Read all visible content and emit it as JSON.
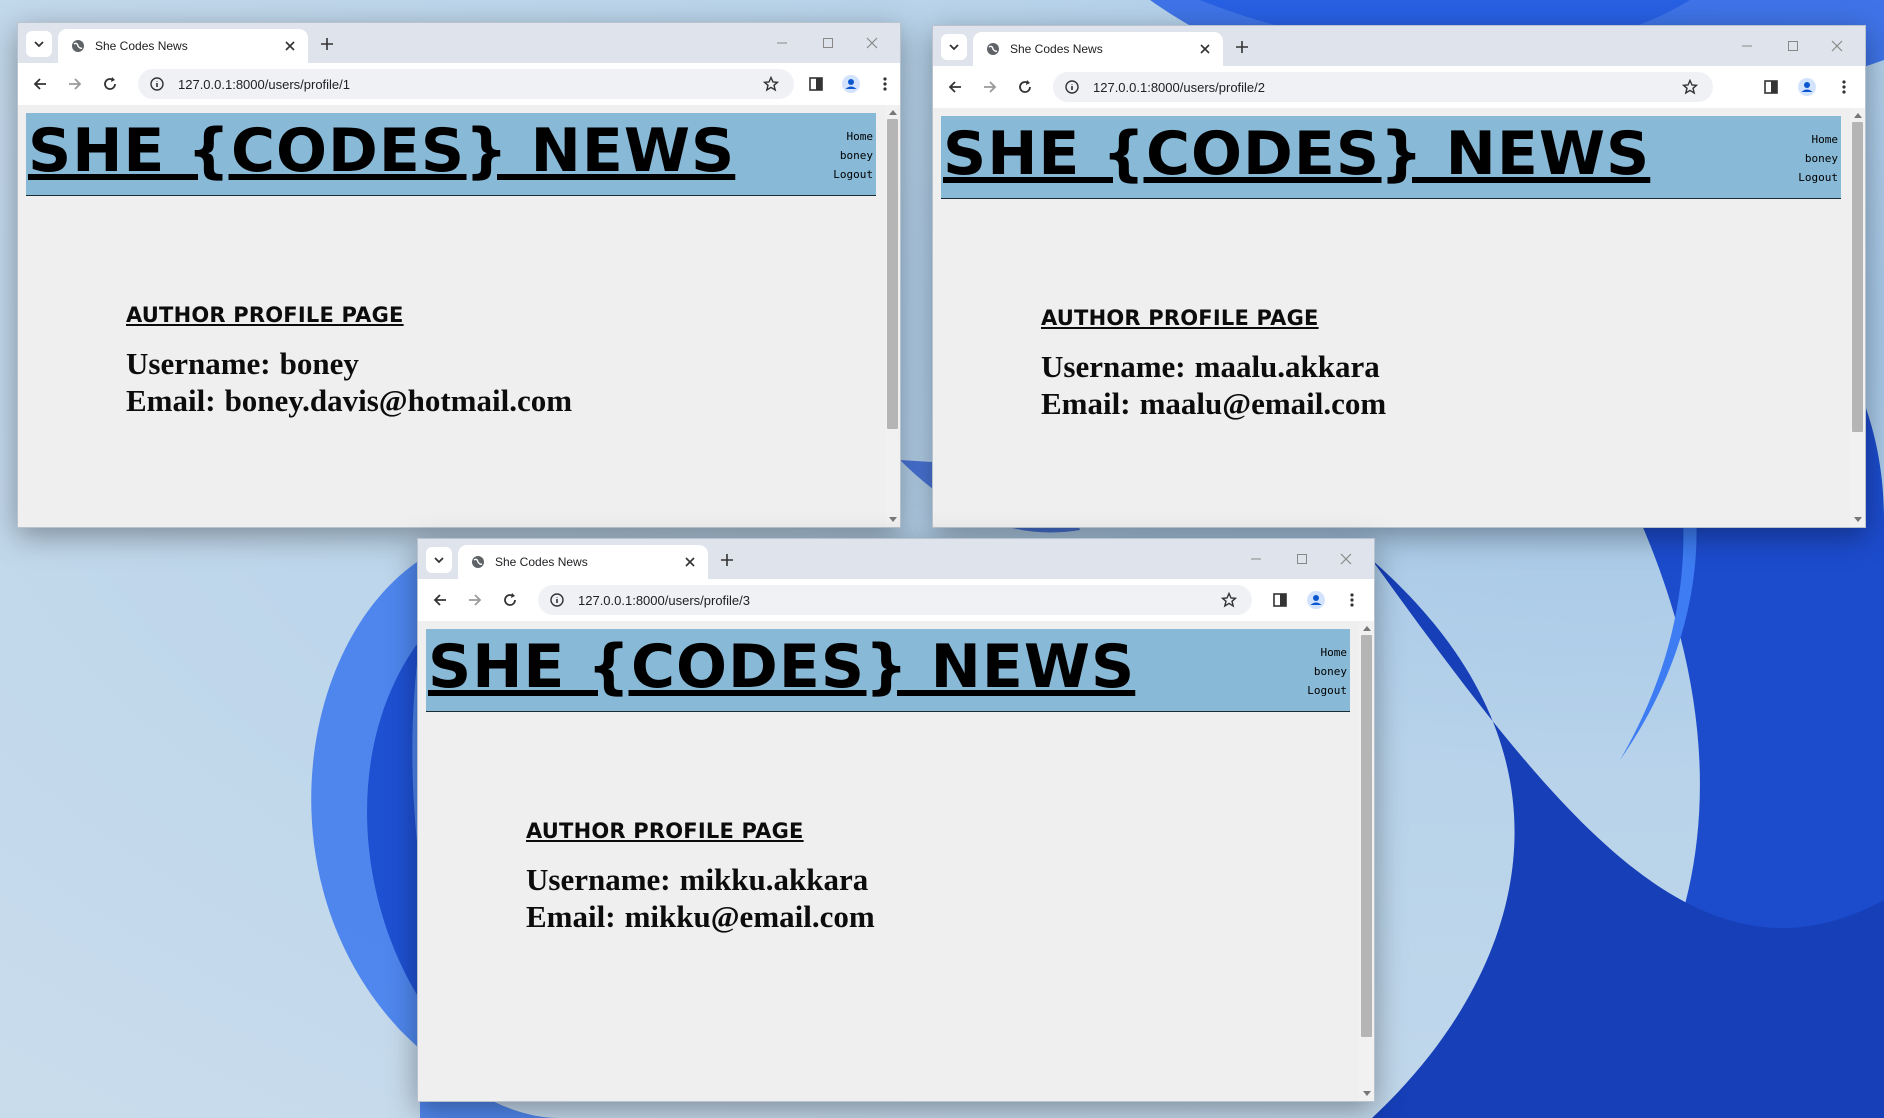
{
  "desktop": {
    "accent": "#1f56d9"
  },
  "windows": [
    {
      "tab_title": "She Codes News",
      "url": "127.0.0.1:8000/users/profile/1",
      "site_title": "SHE {CODES} NEWS",
      "nav": [
        "Home",
        "boney",
        "Logout"
      ],
      "heading": "AUTHOR PROFILE PAGE",
      "username_label": "Username:",
      "username": "boney",
      "email_label": "Email:",
      "email": "boney.davis@hotmail.com"
    },
    {
      "tab_title": "She Codes News",
      "url": "127.0.0.1:8000/users/profile/2",
      "site_title": "SHE {CODES} NEWS",
      "nav": [
        "Home",
        "boney",
        "Logout"
      ],
      "heading": "AUTHOR PROFILE PAGE",
      "username_label": "Username:",
      "username": "maalu.akkara",
      "email_label": "Email:",
      "email": "maalu@email.com"
    },
    {
      "tab_title": "She Codes News",
      "url": "127.0.0.1:8000/users/profile/3",
      "site_title": "SHE {CODES} NEWS",
      "nav": [
        "Home",
        "boney",
        "Logout"
      ],
      "heading": "AUTHOR PROFILE PAGE",
      "username_label": "Username:",
      "username": "mikku.akkara",
      "email_label": "Email:",
      "email": "mikku@email.com"
    }
  ],
  "icons": {
    "tab_search": "chevron-down-icon",
    "favicon": "globe-icon",
    "close_tab": "close-icon",
    "new_tab": "plus-icon",
    "back": "arrow-left-icon",
    "forward": "arrow-right-icon",
    "reload": "reload-icon",
    "site_info": "info-icon",
    "bookmark": "star-icon",
    "side_panel": "side-panel-icon",
    "profile": "profile-icon",
    "menu": "kebab-menu-icon"
  },
  "colors": {
    "header_bg": "#88b9d7",
    "page_bg": "#efefef",
    "tabstrip_bg": "#dfe3eb"
  }
}
